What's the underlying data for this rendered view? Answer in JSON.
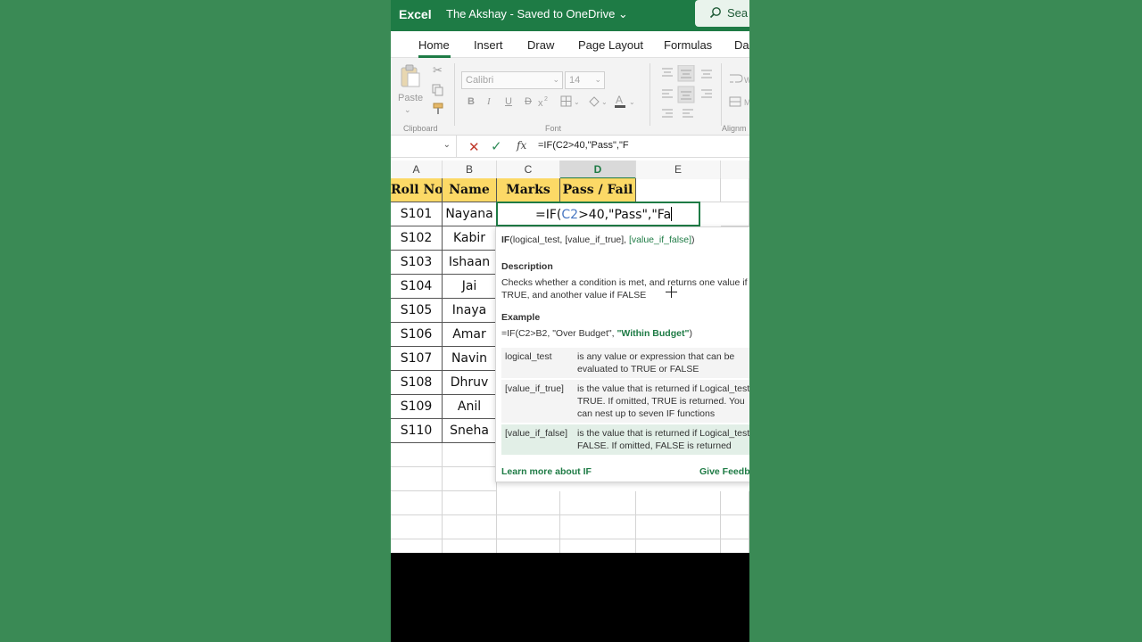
{
  "app": {
    "name": "Excel",
    "doc_title": "The Akshay  -  Saved to OneDrive ⌄",
    "search_label": "Sea"
  },
  "tabs": [
    "Home",
    "Insert",
    "Draw",
    "Page Layout",
    "Formulas",
    "Da"
  ],
  "ribbon": {
    "paste_label": "Paste",
    "font_name": "Calibri",
    "font_size": "14",
    "group_clipboard": "Clipboard",
    "group_font": "Font",
    "group_align": "Alignm",
    "bold": "B",
    "italic": "I",
    "underline": "U",
    "strike": "D"
  },
  "formula_bar": {
    "fx": "fx",
    "text": "=IF(C2>40,\"Pass\",\"F"
  },
  "columns": [
    "A",
    "B",
    "C",
    "D",
    "E",
    ""
  ],
  "table": {
    "headers": [
      "Roll No",
      "Name",
      "Marks",
      "Pass / Fail"
    ],
    "rows": [
      [
        "S101",
        "Nayana"
      ],
      [
        "S102",
        "Kabir"
      ],
      [
        "S103",
        "Ishaan"
      ],
      [
        "S104",
        "Jai"
      ],
      [
        "S105",
        "Inaya"
      ],
      [
        "S106",
        "Amar"
      ],
      [
        "S107",
        "Navin"
      ],
      [
        "S108",
        "Dhruv"
      ],
      [
        "S109",
        "Anil"
      ],
      [
        "S110",
        "Sneha"
      ]
    ]
  },
  "active_cell": {
    "prefix": "=IF(",
    "ref": "C2",
    "suffix": ">40,\"Pass\",\"Fa"
  },
  "tooltip": {
    "sig_fn": "IF",
    "sig_args": "(logical_test, [value_if_true], ",
    "sig_current": "[value_if_false]",
    "sig_end": ")",
    "desc_heading": "Description",
    "desc_text": "Checks whether a condition is met, and returns one value if TRUE, and another value if FALSE",
    "example_heading": "Example",
    "example_prefix": "=IF(C2>B2, \"Over Budget\", ",
    "example_highlight": "\"Within Budget\"",
    "example_end": ")",
    "args": [
      {
        "name": "logical_test",
        "desc": "is any value or expression that can be evaluated to TRUE or FALSE"
      },
      {
        "name": "[value_if_true]",
        "desc": "is the value that is returned if Logical_test is TRUE. If omitted, TRUE is returned. You can nest up to seven IF functions"
      },
      {
        "name": "[value_if_false]",
        "desc": "is the value that is returned if Logical_test is FALSE. If omitted, FALSE is returned"
      }
    ],
    "learn_more": "Learn more about IF",
    "feedback": "Give Feedb"
  },
  "colors": {
    "excel_green": "#1e7b45",
    "header_fill": "#fcd966",
    "background": "#3a8a55"
  }
}
